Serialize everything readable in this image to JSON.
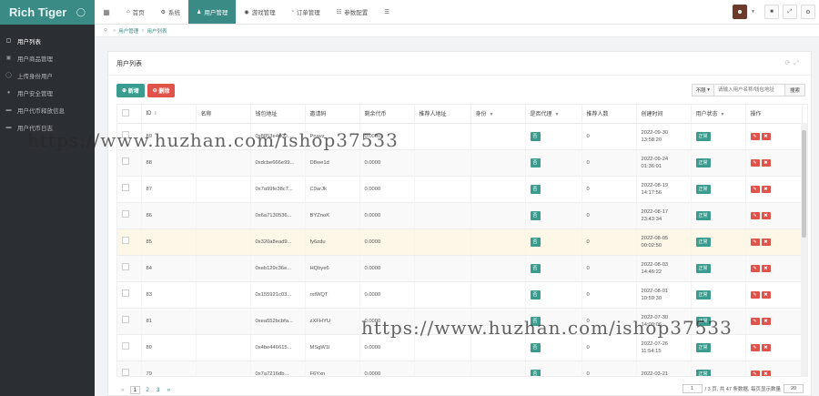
{
  "app": {
    "logo": "Rich Tiger",
    "toggle_icon": "ring-icon"
  },
  "sidebar": {
    "items": [
      {
        "label": "用户列表",
        "icon": "user-list-icon",
        "active": true
      },
      {
        "label": "用户商品管理",
        "icon": "goods-icon",
        "active": false
      },
      {
        "label": "上传身份用户",
        "icon": "id-upload-icon",
        "active": false
      },
      {
        "label": "用户安全管理",
        "icon": "security-icon",
        "active": false
      },
      {
        "label": "用户代币释放信息",
        "icon": "file-icon",
        "active": false
      },
      {
        "label": "用户代币日志",
        "icon": "log-icon",
        "active": false
      }
    ]
  },
  "topbar": {
    "tabs": [
      {
        "label": "首页",
        "icon": "home-icon",
        "active": false
      },
      {
        "label": "系统",
        "icon": "gear-icon",
        "active": false
      },
      {
        "label": "用户管理",
        "icon": "user-icon",
        "active": true
      },
      {
        "label": "游戏管理",
        "icon": "game-icon",
        "active": false
      },
      {
        "label": "订单管理",
        "icon": "order-icon",
        "active": false
      },
      {
        "label": "参数配置",
        "icon": "config-icon",
        "active": false
      }
    ]
  },
  "breadcrumb": {
    "items": [
      "用户管理",
      "用户列表"
    ]
  },
  "panel": {
    "title": "用户列表"
  },
  "toolbar": {
    "add_label": "新增",
    "delete_label": "删除",
    "limit_label": "不限",
    "search_placeholder": "请输入用户名称/钱包地址",
    "search_label": "搜索"
  },
  "table": {
    "headers": [
      "ID",
      "名称",
      "钱包地址",
      "邀请码",
      "剩余代币",
      "推荐人地址",
      "身份",
      "是否代理",
      "推荐人数",
      "创建时间",
      "用户状态",
      "操作"
    ],
    "rows": [
      {
        "id": "89",
        "name": "",
        "wallet": "0x8853e4d00...",
        "code": "Pnavz",
        "tokens": "0.0000",
        "ref": "",
        "identity": "",
        "agent": "否",
        "count": "0",
        "created": "2022-09-30 13:58:20",
        "status": "正常"
      },
      {
        "id": "88",
        "name": "",
        "wallet": "0xdcbe666e99...",
        "code": "D8we1d",
        "tokens": "0.0000",
        "ref": "",
        "identity": "",
        "agent": "否",
        "count": "0",
        "created": "2022-09-24 01:36:01",
        "status": "正常"
      },
      {
        "id": "87",
        "name": "",
        "wallet": "0x7a99fe38c7...",
        "code": "C9arJk",
        "tokens": "0.0000",
        "ref": "",
        "identity": "",
        "agent": "否",
        "count": "0",
        "created": "2022-08-19 14:17:56",
        "status": "正常"
      },
      {
        "id": "86",
        "name": "",
        "wallet": "0x6a7130536...",
        "code": "BYZnoK",
        "tokens": "0.0000",
        "ref": "",
        "identity": "",
        "agent": "否",
        "count": "0",
        "created": "2022-08-17 23:43:34",
        "status": "正常"
      },
      {
        "id": "85",
        "name": "",
        "wallet": "0x320a8ead9...",
        "code": "fy6zdu",
        "tokens": "0.0000",
        "ref": "",
        "identity": "",
        "agent": "否",
        "count": "0",
        "created": "2022-08-05 00:02:50",
        "status": "正常"
      },
      {
        "id": "84",
        "name": "",
        "wallet": "0xeb129c36e...",
        "code": "HQbye6",
        "tokens": "0.0000",
        "ref": "",
        "identity": "",
        "agent": "否",
        "count": "0",
        "created": "2022-08-03 14:46:22",
        "status": "正常"
      },
      {
        "id": "83",
        "name": "",
        "wallet": "0x155921c03...",
        "code": "rxtWQT",
        "tokens": "0.0000",
        "ref": "",
        "identity": "",
        "agent": "否",
        "count": "0",
        "created": "2022-08-01 10:59:30",
        "status": "正常"
      },
      {
        "id": "81",
        "name": "",
        "wallet": "0xea552bcbfa...",
        "code": "zXFHYU",
        "tokens": "0.0000",
        "ref": "",
        "identity": "",
        "agent": "否",
        "count": "0",
        "created": "2022-07-30 14:00:06",
        "status": "正常"
      },
      {
        "id": "80",
        "name": "",
        "wallet": "0x4be446615...",
        "code": "MSgW1l",
        "tokens": "0.0000",
        "ref": "",
        "identity": "",
        "agent": "否",
        "count": "0",
        "created": "2022-07-26 11:54:15",
        "status": "正常"
      },
      {
        "id": "79",
        "name": "",
        "wallet": "0x7a7216db...",
        "code": "F6Yxn",
        "tokens": "0.0000",
        "ref": "",
        "identity": "",
        "agent": "否",
        "count": "0",
        "created": "2022-03-21",
        "status": "正常"
      }
    ]
  },
  "pagination": {
    "prev": "«",
    "pages": [
      "1",
      "2",
      "3"
    ],
    "next": "»",
    "current": "1",
    "total_pages_label": "/ 3 页, 共 47 条数据, 每页显示数量",
    "page_input": "1",
    "page_size": "20"
  },
  "watermark": {
    "text": "https://www.huzhan.com/ishop37533"
  }
}
